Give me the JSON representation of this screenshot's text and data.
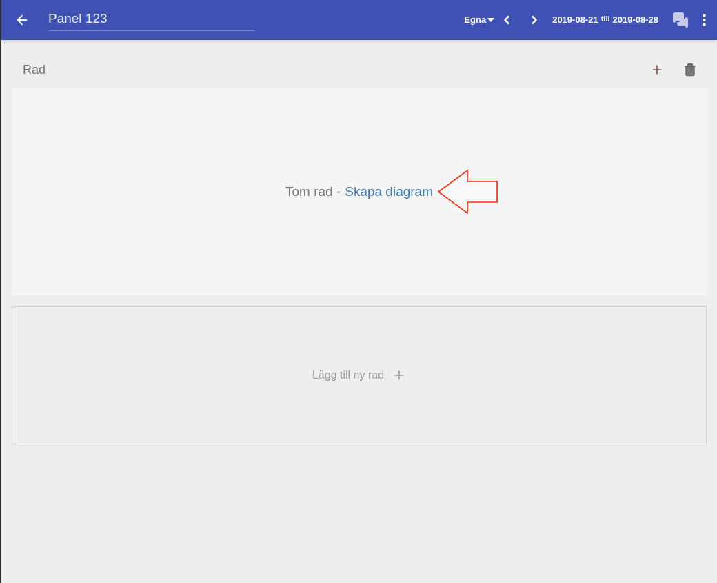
{
  "toolbar": {
    "title_value": "Panel 123",
    "filter": "Egna",
    "date_from": "2019-08-21",
    "date_separator": "till",
    "date_to": "2019-08-28"
  },
  "row": {
    "title": "Rad",
    "empty_text": "Tom rad -",
    "create_link": "Skapa diagram"
  },
  "add_row": {
    "label": "Lägg till ny rad"
  }
}
